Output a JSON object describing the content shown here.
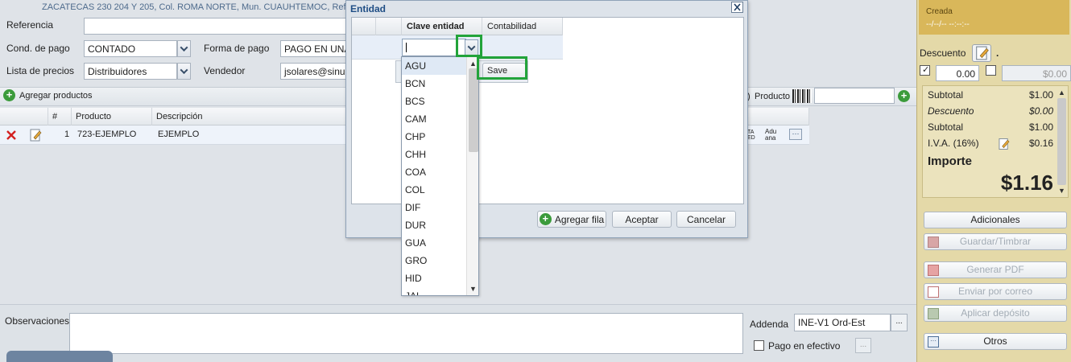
{
  "header": {
    "address": "ZACATECAS 230 204 Y 205, Col. ROMA NORTE, Mun. CUAUHTEMOC, Ref. NE"
  },
  "form": {
    "referencia_label": "Referencia",
    "cond_pago_label": "Cond. de pago",
    "cond_pago_value": "CONTADO",
    "forma_pago_label": "Forma de pago",
    "forma_pago_value": "PAGO EN UNA",
    "lista_precios_label": "Lista de precios",
    "lista_precios_value": "Distribuidores",
    "vendedor_label": "Vendedor",
    "vendedor_value": "jsolares@sinub"
  },
  "toolbar": {
    "agregar_productos": "Agregar productos",
    "producto_label": "Producto",
    "truncated_prefix": ")"
  },
  "grid": {
    "headers": [
      "#",
      "Producto",
      "Descripción"
    ],
    "rows": [
      {
        "num": "1",
        "producto": "723-EJEMPLO",
        "descripcion": "EJEMPLO",
        "aduana": "Adu ana",
        "ta": "TA ED"
      }
    ]
  },
  "bottom": {
    "observaciones_label": "Observaciones",
    "addenda_label": "Addenda",
    "addenda_value": "INE-V1 Ord-Est",
    "pago_efectivo_label": "Pago en efectivo",
    "ellipsis": "..."
  },
  "dialog": {
    "title": "Entidad",
    "col_clave": "Clave entidad",
    "col_contabilidad": "Contabilidad",
    "save_label": "Save",
    "agregar_fila": "Agregar fila",
    "aceptar": "Aceptar",
    "cancelar": "Cancelar",
    "dropdown_items": [
      "AGU",
      "BCN",
      "BCS",
      "CAM",
      "CHP",
      "CHH",
      "COA",
      "COL",
      "DIF",
      "DUR",
      "GUA",
      "GRO",
      "HID",
      "JAL"
    ]
  },
  "right_panel": {
    "status": "Creada",
    "status_date": "--/--/-- --:--:--",
    "descuento_label": "Descuento",
    "descuento_dot": ".",
    "descuento_value": "0.00",
    "descuento_amount": "$0.00",
    "subtotal1_label": "Subtotal",
    "subtotal1_value": "$1.00",
    "descuento2_label": "Descuento",
    "descuento2_value": "$0.00",
    "subtotal2_label": "Subtotal",
    "subtotal2_value": "$1.00",
    "iva_label": "I.V.A. (16%)",
    "iva_value": "$0.16",
    "importe_label": "Importe",
    "importe_value": "$1.16",
    "btn_adicionales": "Adicionales",
    "btn_guardar": "Guardar/Timbrar",
    "btn_pdf": "Generar PDF",
    "btn_correo": "Enviar por correo",
    "btn_deposito": "Aplicar depósito",
    "btn_otros": "Otros"
  },
  "colors": {
    "accent_green": "#22a33a",
    "status_panel": "#d9b75a",
    "dialog_title": "#1f4e85"
  }
}
